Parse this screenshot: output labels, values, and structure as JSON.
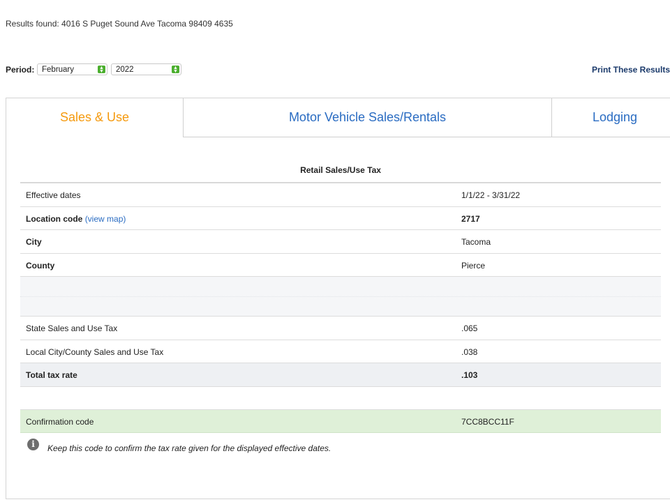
{
  "results": "Results found: 4016 S Puget Sound Ave Tacoma 98409 4635",
  "period": {
    "label": "Period:",
    "month": "February",
    "year": "2022"
  },
  "print_label": "Print These Results",
  "tabs": [
    {
      "label": "Sales & Use"
    },
    {
      "label": "Motor Vehicle Sales/Rentals"
    },
    {
      "label": "Lodging"
    }
  ],
  "table": {
    "caption": "Retail Sales/Use Tax",
    "effective_dates": {
      "label": "Effective dates",
      "value": "1/1/22 - 3/31/22"
    },
    "location_code": {
      "label": "Location code",
      "link": "(view map)",
      "value": "2717"
    },
    "city": {
      "label": "City",
      "value": "Tacoma"
    },
    "county": {
      "label": "County",
      "value": "Pierce"
    },
    "state_tax": {
      "label": "State Sales and Use Tax",
      "value": ".065"
    },
    "local_tax": {
      "label": "Local City/County Sales and Use Tax",
      "value": ".038"
    },
    "total": {
      "label": "Total tax rate",
      "value": ".103"
    },
    "confirmation": {
      "label": "Confirmation code",
      "value": "7CC8BCC11F"
    }
  },
  "note": "Keep this code to confirm the tax rate given for the displayed effective dates.",
  "colors": {
    "active_tab": "#f59a0e",
    "link": "#2a6cc2",
    "select_arrow": "#4caf2f",
    "confirm_bg": "#dff0d8"
  }
}
